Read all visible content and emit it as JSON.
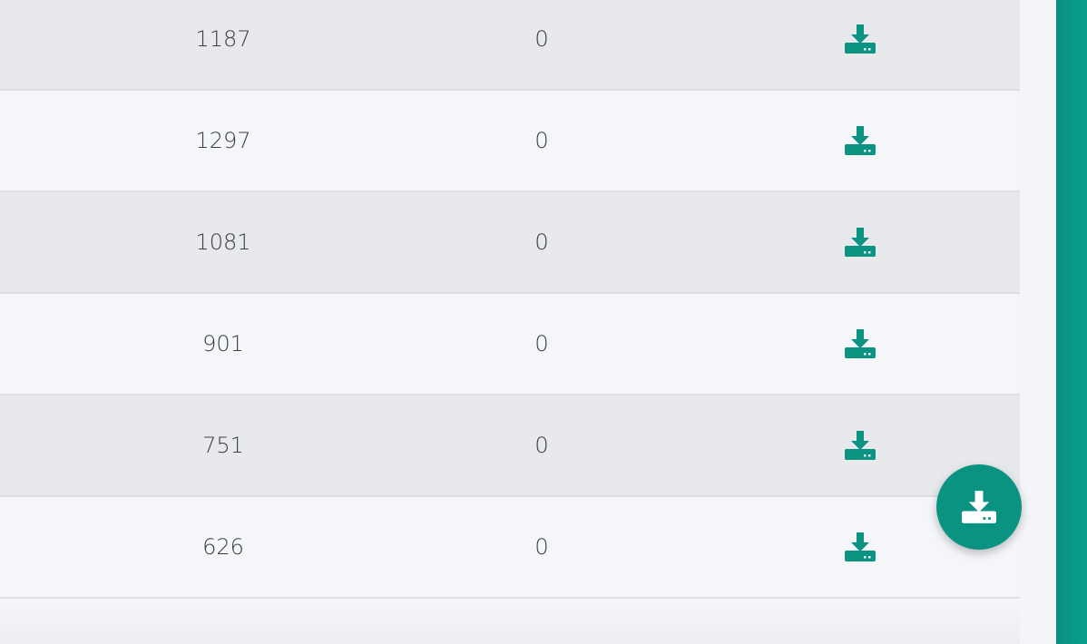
{
  "colors": {
    "accent": "#0b9382",
    "row_odd": "#e8e9ec",
    "row_even": "#f4f6fa",
    "text": "#3c3f44"
  },
  "table": {
    "rows": [
      {
        "count": "1187",
        "value": "0",
        "action_icon": "download-icon"
      },
      {
        "count": "1297",
        "value": "0",
        "action_icon": "download-icon"
      },
      {
        "count": "1081",
        "value": "0",
        "action_icon": "download-icon"
      },
      {
        "count": "901",
        "value": "0",
        "action_icon": "download-icon"
      },
      {
        "count": "751",
        "value": "0",
        "action_icon": "download-icon"
      },
      {
        "count": "626",
        "value": "0",
        "action_icon": "download-icon"
      }
    ]
  },
  "fab": {
    "icon": "download-icon"
  }
}
